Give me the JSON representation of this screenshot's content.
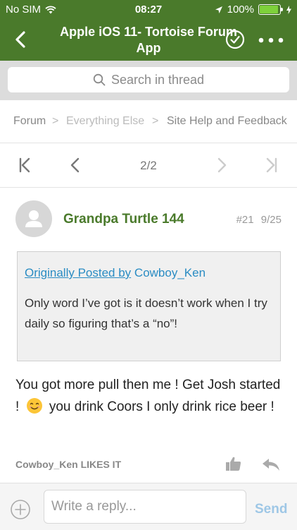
{
  "status_bar": {
    "carrier": "No SIM",
    "time": "08:27",
    "battery": "100%"
  },
  "nav": {
    "title": "Apple iOS 11- Tortoise Forum App"
  },
  "search": {
    "placeholder": "Search in thread"
  },
  "breadcrumb": {
    "items": [
      "Forum",
      "Everything Else",
      "Site Help and Feedback"
    ]
  },
  "pagination": {
    "label": "2/2"
  },
  "post": {
    "author": "Grandpa Turtle 144",
    "number": "#21",
    "date": "9/25",
    "quote": {
      "prefix": "Originally Posted by",
      "author": "Cowboy_Ken",
      "text": "Only word I’ve got is it doesn’t work when I try daily so figuring that’s a “no”!"
    },
    "body_part1": "You got more pull then me ! Get Josh started !",
    "body_part2": "you drink Coors I only drink rice beer !",
    "likes_text": "Cowboy_Ken LIKES IT"
  },
  "composer": {
    "placeholder": "Write a reply...",
    "send_label": "Send"
  },
  "colors": {
    "brand_green": "#4a7a2b",
    "link_blue": "#2a8cc3",
    "send_blue": "#9ec7e6"
  },
  "icons": [
    "wifi-icon",
    "location-arrow-icon",
    "battery-icon",
    "charging-icon",
    "back-chevron-icon",
    "checkmark-circle-icon",
    "more-dots-icon",
    "search-icon",
    "first-page-icon",
    "prev-page-icon",
    "next-page-icon",
    "last-page-icon",
    "avatar-placeholder-icon",
    "smile-emoji-icon",
    "thumbs-up-icon",
    "reply-icon",
    "plus-circle-icon"
  ]
}
